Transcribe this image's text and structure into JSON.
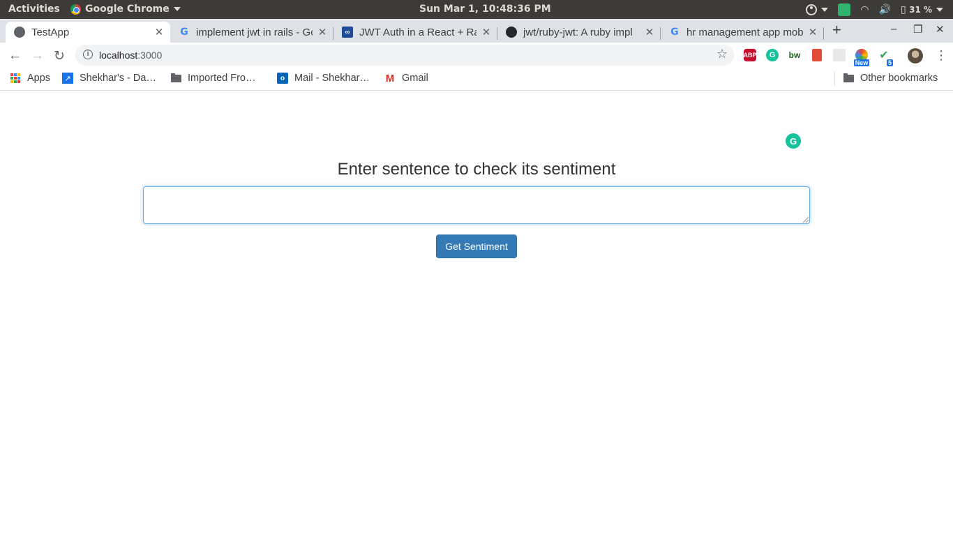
{
  "system_bar": {
    "activities": "Activities",
    "app_name": "Google Chrome",
    "clock": "Sun Mar  1, 10:48:36 PM",
    "battery": "31 %"
  },
  "tabs": [
    {
      "title": "TestApp",
      "icon": "globe-icon",
      "active": true
    },
    {
      "title": "implement jwt in rails - Go",
      "icon": "google-icon",
      "active": false
    },
    {
      "title": "JWT Auth in a React + Rai",
      "icon": "infinity-icon",
      "active": false
    },
    {
      "title": "jwt/ruby-jwt: A ruby impl",
      "icon": "github-icon",
      "active": false
    },
    {
      "title": "hr management app mob",
      "icon": "google-icon",
      "active": false
    }
  ],
  "toolbar": {
    "url_host": "localhost",
    "url_port": ":3000"
  },
  "extensions": {
    "abp": "ABP",
    "new_badge": "New",
    "count_badge": "5"
  },
  "bookmarks": {
    "apps": "Apps",
    "items": [
      "Shekhar's - Da…",
      "Imported Fro…",
      "Mail - Shekhar…",
      "Gmail"
    ],
    "other": "Other bookmarks"
  },
  "page": {
    "heading": "Enter sentence to check its sentiment",
    "input_value": "",
    "button_label": "Get Sentiment"
  },
  "colors": {
    "primary_button": "#337ab7",
    "focus_border": "#66afe9",
    "grammarly": "#15c39a"
  }
}
